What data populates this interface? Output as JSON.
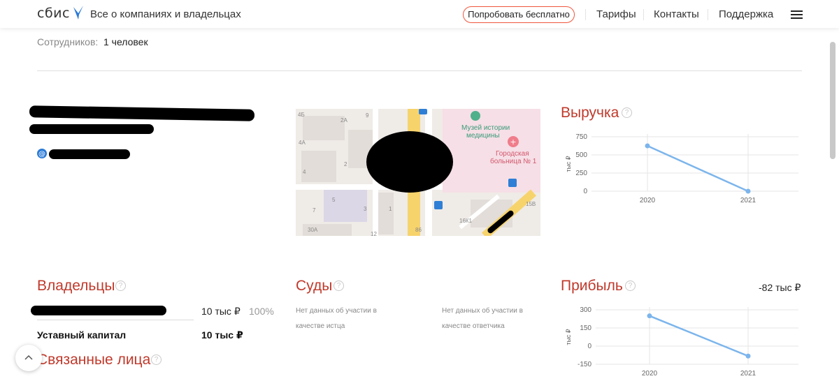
{
  "header": {
    "logo_text": "сбис",
    "tagline": "Все о компаниях и владельцах",
    "try_button": "Попробовать бесплатно",
    "nav": [
      "Тарифы",
      "Контакты",
      "Поддержка"
    ]
  },
  "employees": {
    "label": "Сотрудников:",
    "value": "1 человек"
  },
  "map": {
    "museum_label_1": "Музей истории",
    "museum_label_2": "медицины",
    "hospital_label_1": "Городская",
    "hospital_label_2": "больница № 1",
    "house_numbers": [
      "4Б",
      "2А",
      "9",
      "4А",
      "2",
      "4",
      "5",
      "7",
      "3",
      "1",
      "30А",
      "86",
      "12",
      "16К1",
      "15В"
    ]
  },
  "revenue": {
    "title": "Выручка",
    "help": "?"
  },
  "owners": {
    "title": "Владельцы",
    "help": "?",
    "owner_share": "10 тыс ₽",
    "owner_pct": "100%",
    "capital_label": "Уставный капитал",
    "capital_value": "10 тыс ₽"
  },
  "courts": {
    "title": "Суды",
    "help": "?",
    "plaintiff_1": "Нет данных об участии в",
    "plaintiff_2": "качестве истца",
    "defendant_1": "Нет данных об участии в",
    "defendant_2": "качестве ответчика"
  },
  "profit": {
    "title": "Прибыль",
    "help": "?",
    "value": "-82 тыс ₽"
  },
  "related": {
    "title": "Связанные лица",
    "help": "?"
  },
  "colors": {
    "accent": "#c0392b",
    "line": "#7cb5ec",
    "button_border": "#f0553c"
  },
  "chart_data": [
    {
      "type": "line",
      "title": "Выручка",
      "ylabel": "тыс ₽",
      "x": [
        "2020",
        "2021"
      ],
      "values": [
        625,
        0
      ],
      "y_ticks": [
        "0",
        "250",
        "500",
        "750"
      ],
      "ylim": [
        0,
        750
      ]
    },
    {
      "type": "line",
      "title": "Прибыль",
      "ylabel": "тыс ₽",
      "x": [
        "2020",
        "2021"
      ],
      "values": [
        250,
        -82
      ],
      "y_ticks": [
        "-150",
        "0",
        "150",
        "300"
      ],
      "ylim": [
        -150,
        300
      ]
    }
  ]
}
